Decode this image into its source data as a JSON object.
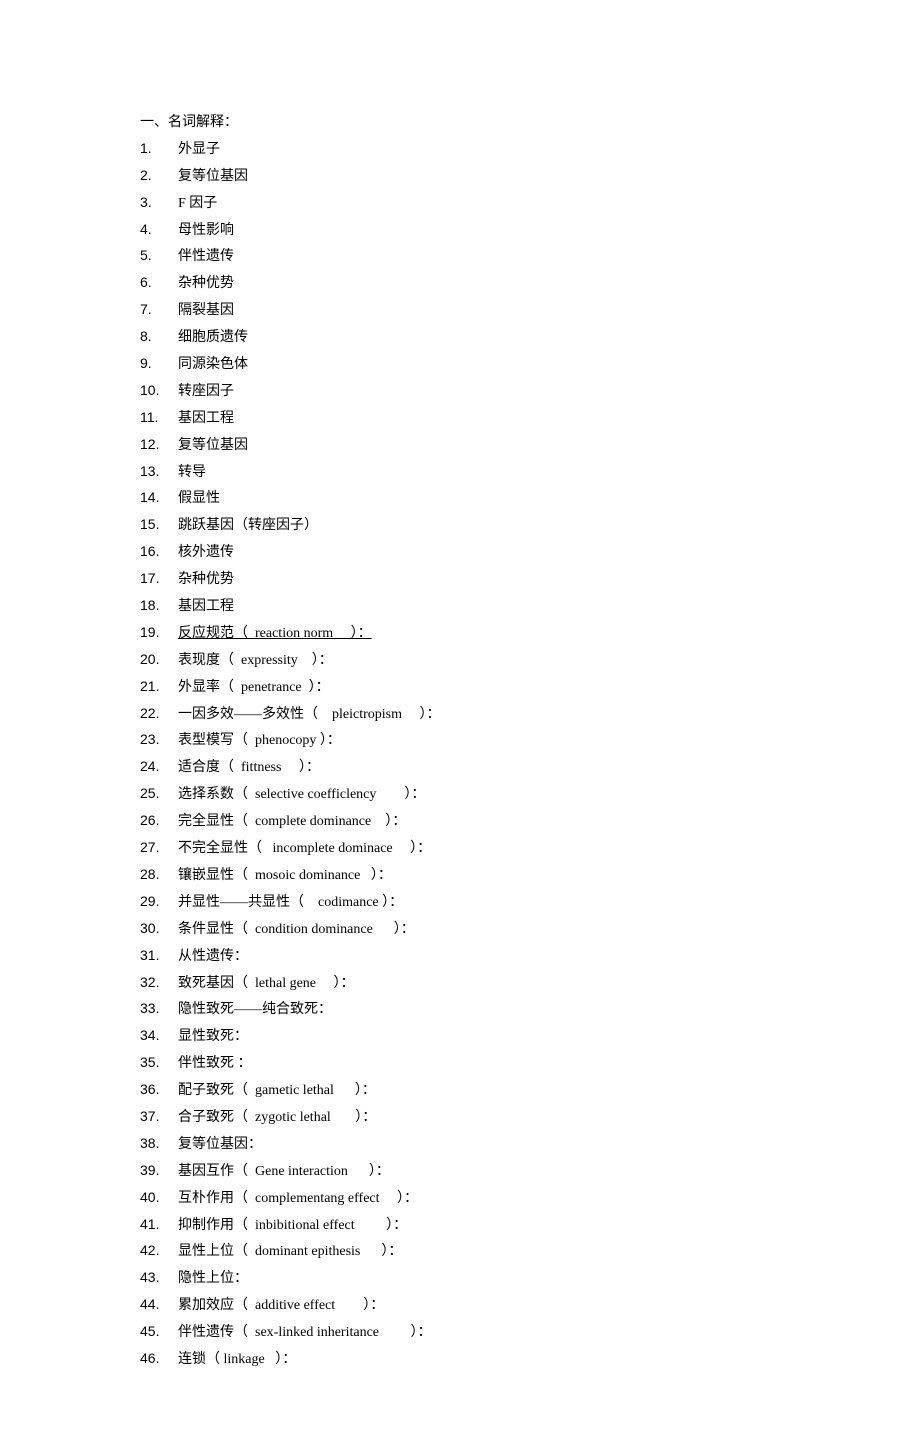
{
  "section_title": "一、名词解释：",
  "items": [
    {
      "num": "1.",
      "text": "外显子"
    },
    {
      "num": "2.",
      "text": "复等位基因"
    },
    {
      "num": "3.",
      "text": "F 因子"
    },
    {
      "num": "4.",
      "text": "母性影响"
    },
    {
      "num": "5.",
      "text": "伴性遗传"
    },
    {
      "num": "6.",
      "text": "杂种优势"
    },
    {
      "num": "7.",
      "text": "隔裂基因"
    },
    {
      "num": "8.",
      "text": "细胞质遗传"
    },
    {
      "num": "9.",
      "text": "同源染色体"
    },
    {
      "num": "10.",
      "text": "转座因子"
    },
    {
      "num": "11.",
      "text": "基因工程"
    },
    {
      "num": "12.",
      "text": "复等位基因"
    },
    {
      "num": "13.",
      "text": "转导"
    },
    {
      "num": "14.",
      "text": "假显性"
    },
    {
      "num": "15.",
      "text": "跳跃基因（转座因子）"
    },
    {
      "num": "16.",
      "text": "核外遗传"
    },
    {
      "num": "17.",
      "text": "杂种优势"
    },
    {
      "num": "18.",
      "text": "基因工程"
    },
    {
      "num": "19.",
      "text": "反应规范（  reaction norm     ）：",
      "underline": true
    },
    {
      "num": "20.",
      "text": "表现度（  expressity    ）："
    },
    {
      "num": "21.",
      "text": "外显率（  penetrance  ）："
    },
    {
      "num": "22.",
      "text": "一因多效——多效性（    pleictropism     ）："
    },
    {
      "num": "23.",
      "text": "表型模写（  phenocopy ）："
    },
    {
      "num": "24.",
      "text": "适合度（  fittness     ）："
    },
    {
      "num": "25.",
      "text": "选择系数（  selective coefficlency        ）："
    },
    {
      "num": "26.",
      "text": "完全显性（  complete dominance    ）："
    },
    {
      "num": "27.",
      "text": "不完全显性（   incomplete dominace     ）："
    },
    {
      "num": "28.",
      "text": "镶嵌显性（  mosoic dominance   ）："
    },
    {
      "num": "29.",
      "text": "并显性——共显性（    codimance ）："
    },
    {
      "num": "30.",
      "text": "条件显性（  condition dominance      ）："
    },
    {
      "num": "31.",
      "text": "从性遗传："
    },
    {
      "num": "32.",
      "text": "致死基因（  lethal gene     ）："
    },
    {
      "num": "33.",
      "text": "隐性致死——纯合致死："
    },
    {
      "num": "34.",
      "text": "显性致死："
    },
    {
      "num": "35.",
      "text": "伴性致死 ："
    },
    {
      "num": "36.",
      "text": "配子致死（  gametic lethal      ）："
    },
    {
      "num": "37.",
      "text": "合子致死（  zygotic lethal       ）："
    },
    {
      "num": "38.",
      "text": "复等位基因："
    },
    {
      "num": "39.",
      "text": "基因互作（  Gene interaction      ）："
    },
    {
      "num": "40.",
      "text": "互朴作用（  complementang effect     ）："
    },
    {
      "num": "41.",
      "text": "抑制作用（  inbibitional effect         ）："
    },
    {
      "num": "42.",
      "text": "显性上位（  dominant epithesis      ）："
    },
    {
      "num": "43.",
      "text": "隐性上位："
    },
    {
      "num": "44.",
      "text": "累加效应（  additive effect        ）："
    },
    {
      "num": "45.",
      "text": "伴性遗传（  sex-linked inheritance         ）："
    },
    {
      "num": "46.",
      "text": "连锁（ linkage   ）："
    }
  ]
}
